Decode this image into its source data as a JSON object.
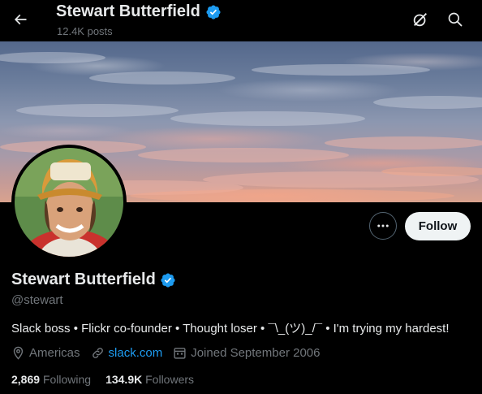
{
  "header": {
    "name": "Stewart Butterfield",
    "posts_count": "12.4K posts",
    "icons": [
      "back-arrow-icon",
      "grok-icon",
      "search-icon"
    ]
  },
  "profile": {
    "name": "Stewart Butterfield",
    "verified": true,
    "handle": "@stewart",
    "bio": "Slack boss • Flickr co-founder • Thought loser • ¯\\_(ツ)_/¯ • I'm trying my hardest!",
    "location": "Americas",
    "website": "slack.com",
    "joined": "Joined September 2006",
    "following_count": "2,869",
    "following_label": "Following",
    "followers_count": "134.9K",
    "followers_label": "Followers"
  },
  "actions": {
    "follow_label": "Follow"
  },
  "colors": {
    "background": "#000000",
    "primary_text": "#e7e9ea",
    "secondary_text": "#71767b",
    "link": "#1d9bf0",
    "verified_badge": "#1d9bf0",
    "follow_button_bg": "#eff3f4"
  }
}
